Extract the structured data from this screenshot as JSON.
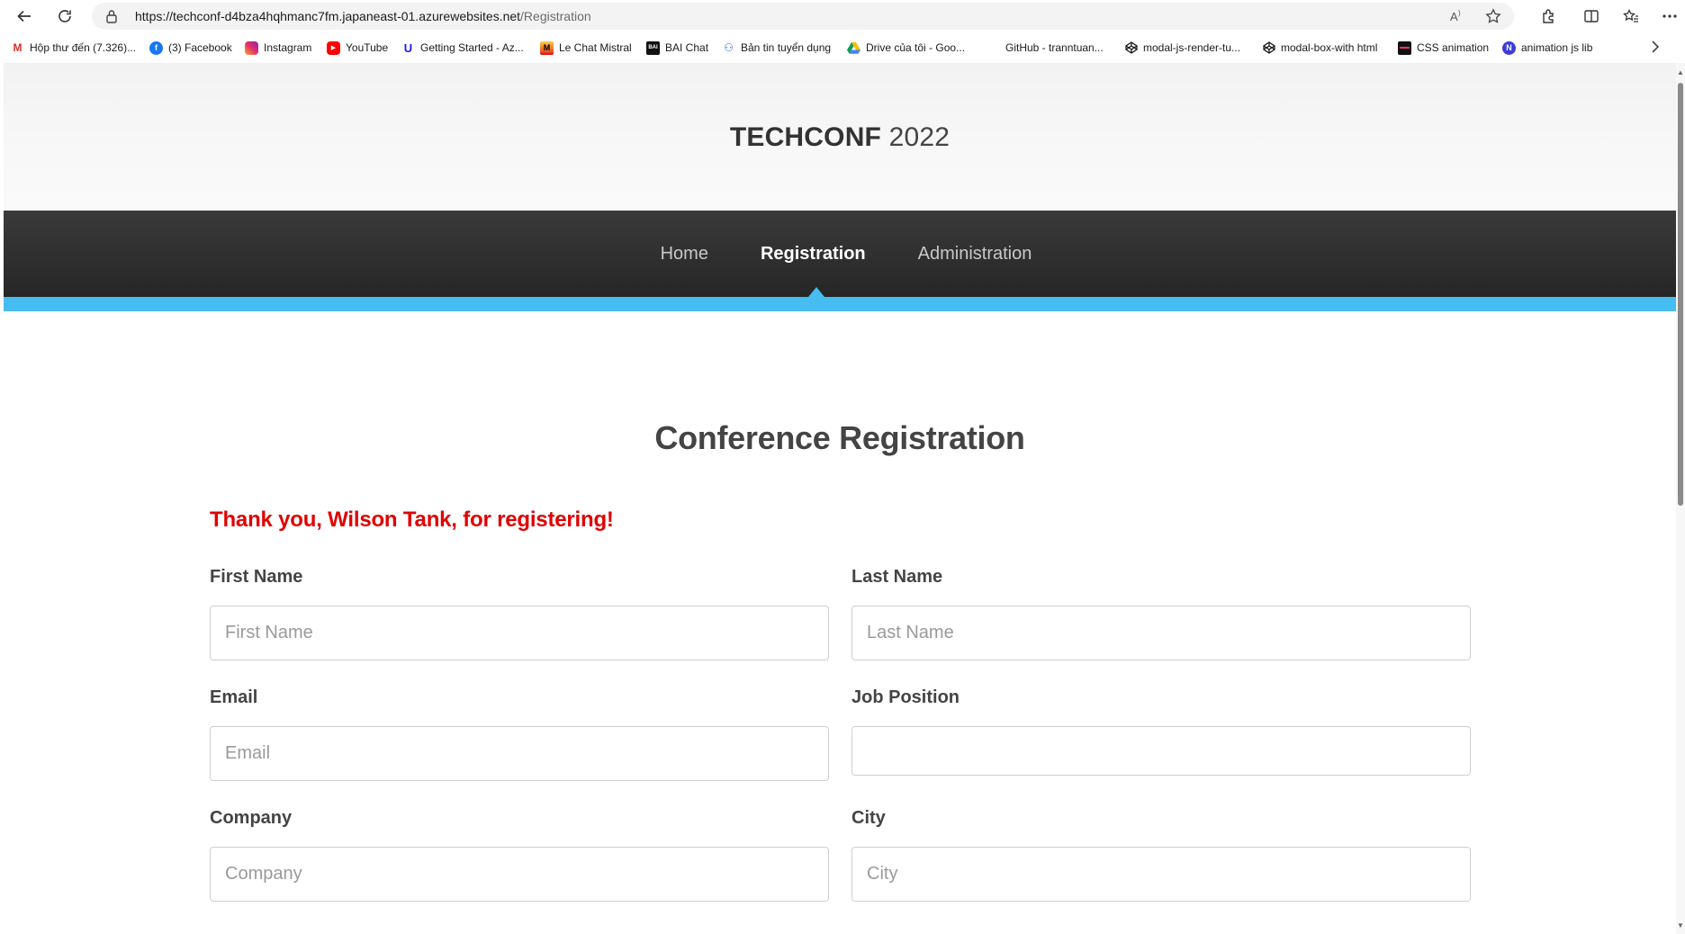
{
  "browser": {
    "url_host": "https://techconf-d4bza4hqhmanc7fm.japaneast-01.azurewebsites.net",
    "url_path": "/Registration"
  },
  "bookmarks": [
    {
      "label": "Hộp thư đến (7.326)...",
      "icon": "gmail-icon",
      "color": "#d93025"
    },
    {
      "label": "(3) Facebook",
      "icon": "facebook-icon",
      "color": "#1877f2"
    },
    {
      "label": "Instagram",
      "icon": "instagram-icon",
      "color": "#e1306c"
    },
    {
      "label": "YouTube",
      "icon": "youtube-icon",
      "color": "#ff0000"
    },
    {
      "label": "Getting Started - Az...",
      "icon": "udacity-icon",
      "color": "#2015ff"
    },
    {
      "label": "Le Chat Mistral",
      "icon": "mistral-icon",
      "color": "#f7d046"
    },
    {
      "label": "BAI Chat",
      "icon": "baichat-icon",
      "color": "#111111"
    },
    {
      "label": "Bản tin tuyển dụng",
      "icon": "jobs-icon",
      "color": "#2d6cdf"
    },
    {
      "label": "Drive của tôi - Goo...",
      "icon": "drive-icon",
      "color": "#0f9d58"
    },
    {
      "label": "GitHub - tranntuan...",
      "icon": "github-icon",
      "color": "#ffffff"
    },
    {
      "label": "modal-js-render-tu...",
      "icon": "codepen-icon",
      "color": "#111111"
    },
    {
      "label": "modal-box-with html",
      "icon": "codepen-icon",
      "color": "#111111"
    },
    {
      "label": "CSS animation",
      "icon": "css-icon",
      "color": "#111111"
    },
    {
      "label": "animation js lib",
      "icon": "notion-icon",
      "color": "#3d3dd6"
    }
  ],
  "site": {
    "brand_bold": "TECHCONF",
    "brand_year": " 2022",
    "nav": {
      "home": "Home",
      "registration": "Registration",
      "administration": "Administration"
    },
    "accent_color": "#45bdf0"
  },
  "registration": {
    "title": "Conference Registration",
    "thanks_message": "Thank you, Wilson Tank, for registering!",
    "fields": {
      "first_name": {
        "label": "First Name",
        "placeholder": "First Name",
        "value": ""
      },
      "last_name": {
        "label": "Last Name",
        "placeholder": "Last Name",
        "value": ""
      },
      "email": {
        "label": "Email",
        "placeholder": "Email",
        "value": ""
      },
      "job_position": {
        "label": "Job Position",
        "placeholder": "",
        "value": ""
      },
      "company": {
        "label": "Company",
        "placeholder": "Company",
        "value": ""
      },
      "city": {
        "label": "City",
        "placeholder": "City",
        "value": ""
      }
    }
  }
}
